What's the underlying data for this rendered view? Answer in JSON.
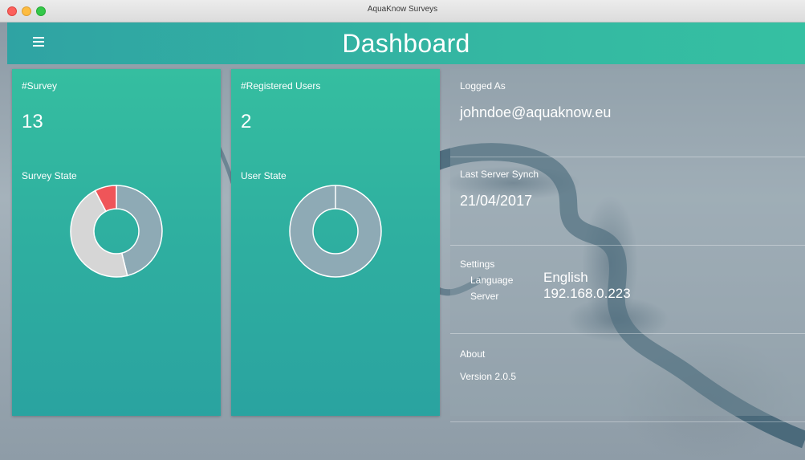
{
  "window": {
    "title": "AquaKnow Surveys"
  },
  "appbar": {
    "title": "Dashboard",
    "menu_icon": "hamburger-menu-icon"
  },
  "survey_card": {
    "count_label": "#Survey",
    "count_value": "13",
    "state_label": "Survey State",
    "chart_data": {
      "type": "pie",
      "title": "",
      "values": [
        6,
        6,
        1
      ],
      "colors": [
        "#8eaab5",
        "#d6d6d6",
        "#ef5559"
      ]
    }
  },
  "users_card": {
    "count_label": "#Registered Users",
    "count_value": "2",
    "state_label": "User State",
    "chart_data": {
      "type": "pie",
      "title": "",
      "values": [
        2
      ],
      "colors": [
        "#8eaab5"
      ]
    }
  },
  "info": {
    "logged": {
      "label": "Logged As",
      "value": "johndoe@aquaknow.eu"
    },
    "synch": {
      "label": "Last Server Synch",
      "value": "21/04/2017"
    },
    "settings": {
      "label": "Settings",
      "language_key": "Language",
      "language_value": "English",
      "server_key": "Server",
      "server_value": "192.168.0.223"
    },
    "about": {
      "label": "About",
      "version": "Version 2.0.5"
    }
  }
}
